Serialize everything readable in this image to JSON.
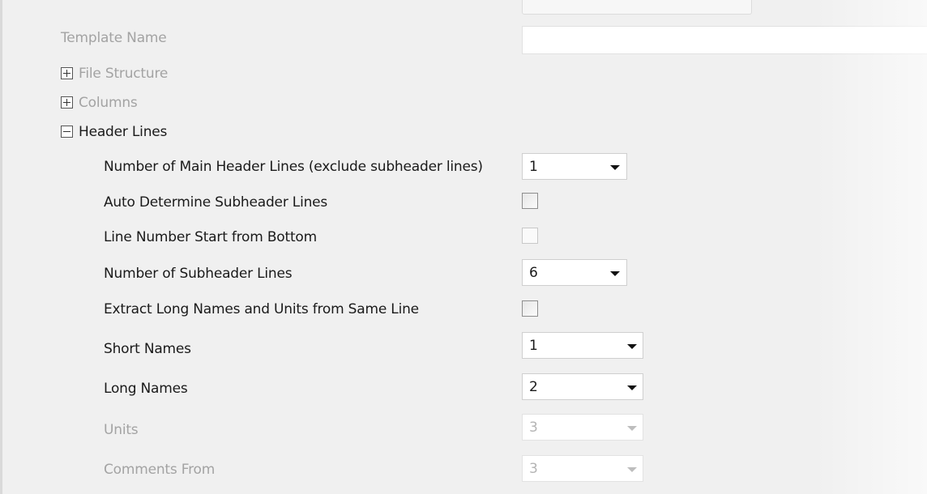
{
  "template": {
    "label": "Template Name",
    "value": ""
  },
  "tree": {
    "file_structure": "File Structure",
    "columns": "Columns",
    "header_lines": "Header Lines"
  },
  "header_lines": {
    "main_header": {
      "label": "Number of Main Header Lines (exclude subheader lines)",
      "value": "1"
    },
    "auto_determine": {
      "label": "Auto Determine Subheader Lines",
      "checked": false
    },
    "line_number_bottom": {
      "label": "Line Number Start from Bottom",
      "checked": false
    },
    "subheader_lines": {
      "label": "Number of Subheader Lines",
      "value": "6"
    },
    "extract_long_names": {
      "label": "Extract Long Names and Units from Same Line",
      "checked": false
    },
    "short_names": {
      "label": "Short Names",
      "value": "1"
    },
    "long_names": {
      "label": "Long Names",
      "value": "2"
    },
    "units": {
      "label": "Units",
      "value": "3"
    },
    "comments_from": {
      "label": "Comments From",
      "value": "3"
    }
  },
  "icons": {
    "expand": "plus-box-icon",
    "collapse": "minus-box-icon",
    "dropdown": "chevron-down-icon"
  }
}
